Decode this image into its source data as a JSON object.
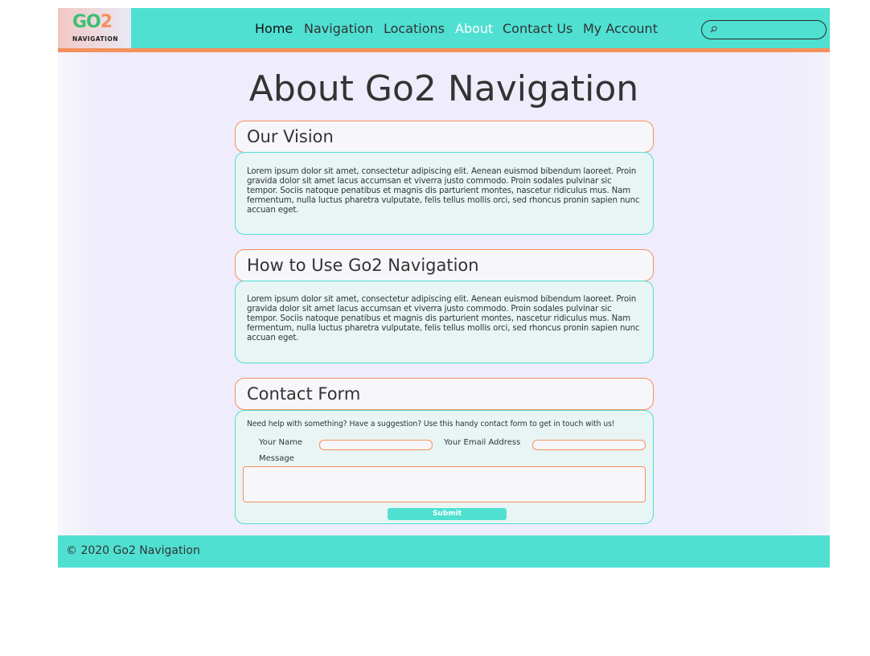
{
  "logo": {
    "text_go": "GO",
    "text_two": "2",
    "subtitle": "NAVIGATION"
  },
  "nav": {
    "items": [
      {
        "label": "Home"
      },
      {
        "label": "Navigation"
      },
      {
        "label": "Locations"
      },
      {
        "label": "About"
      },
      {
        "label": "Contact Us"
      },
      {
        "label": "My Account"
      }
    ],
    "active": "About"
  },
  "search": {
    "value": "",
    "icon": "search-icon"
  },
  "page": {
    "title": "About Go2 Navigation"
  },
  "sections": [
    {
      "heading": "Our Vision",
      "body": "Lorem ipsum dolor sit amet, consectetur adipiscing elit. Aenean euismod bibendum laoreet. Proin gravida dolor sit amet lacus accumsan et viverra justo commodo. Proin sodales pulvinar sic tempor. Sociis natoque penatibus et magnis dis parturient montes, nascetur ridiculus mus. Nam fermentum, nulla luctus pharetra vulputate, felis tellus mollis orci, sed rhoncus pronin sapien nunc accuan eget."
    },
    {
      "heading": "How to Use Go2 Navigation",
      "body": "Lorem ipsum dolor sit amet, consectetur adipiscing elit. Aenean euismod bibendum laoreet. Proin gravida dolor sit amet lacus accumsan et viverra justo commodo. Proin sodales pulvinar sic tempor. Sociis natoque penatibus et magnis dis parturient montes, nascetur ridiculus mus. Nam fermentum, nulla luctus pharetra vulputate, felis tellus mollis orci, sed rhoncus pronin sapien nunc accuan eget."
    }
  ],
  "contact": {
    "heading": "Contact Form",
    "intro": "Need help with something? Have a suggestion? Use this handy contact form to get in touch with us!",
    "name_label": "Your Name",
    "name_value": "",
    "email_label": "Your Email Address",
    "email_value": "",
    "message_label": "Message",
    "message_value": "",
    "submit_label": "Submit"
  },
  "footer": {
    "text": "© 2020 Go2 Navigation"
  },
  "colors": {
    "header": "#4fe0d2",
    "accent": "#f5915c",
    "logo_go": "#3ebf74",
    "page_bg": "#efecfb",
    "section_body_bg": "#e8f5f4"
  }
}
